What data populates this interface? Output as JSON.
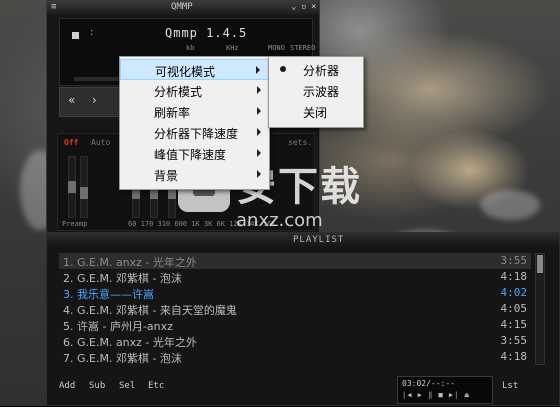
{
  "main_window": {
    "title": "QMMP",
    "version": "Qmmp 1.4.5",
    "colon": ":",
    "labels": {
      "kb": "kb",
      "khz": "KHz",
      "mono": "MONO",
      "stereo": "STEREO"
    },
    "controls": {
      "prev": "«",
      "play": "›"
    },
    "equalizer": {
      "off": "Off",
      "auto": "Auto",
      "presets": "sets.",
      "preamp": "Preamp",
      "freq": "60 170 310 600 1K 3K 6K 12K 14K 16K"
    }
  },
  "context_menu": {
    "items": [
      {
        "label": "可视化模式",
        "highlighted": true
      },
      {
        "label": "分析模式"
      },
      {
        "label": "刷新率"
      },
      {
        "label": "分析器下降速度"
      },
      {
        "label": "峰值下降速度"
      },
      {
        "label": "背景"
      }
    ]
  },
  "submenu": {
    "items": [
      {
        "label": "分析器",
        "checked": true
      },
      {
        "label": "示波器"
      },
      {
        "label": "关闭"
      }
    ]
  },
  "playlist": {
    "title": "PLAYLIST",
    "tracks": [
      {
        "title": "1. G.E.M. anxz - 光年之外",
        "duration": "3:55"
      },
      {
        "title": "2. G.E.M. 邓紫棋 - 泡沫",
        "duration": "4:18"
      },
      {
        "title": "3. 我乐意——许嵩",
        "duration": "4:02"
      },
      {
        "title": "4. G.E.M. 邓紫棋 - 来自天堂的魔鬼",
        "duration": "4:05"
      },
      {
        "title": "5. 许嵩 - 庐州月-anxz",
        "duration": "4:15"
      },
      {
        "title": "6. G.E.M. anxz - 光年之外",
        "duration": "3:55"
      },
      {
        "title": "7. G.E.M. 邓紫棋 - 泡沫",
        "duration": "4:18"
      }
    ],
    "buttons": {
      "add": "Add",
      "sub": "Sub",
      "sel": "Sel",
      "etc": "Etc",
      "lst": "Lst"
    },
    "mini_time": "03:02/--:--",
    "mini_controls": "|◀ ▶ ‖ ■ ▶| ⏏"
  },
  "watermark": {
    "text": "安下载",
    "url": "anxz.com"
  },
  "colors": {
    "current_track": "#4aa6ff",
    "eq_off": "#e03a1e",
    "menu_highlight": "#cde8ff"
  }
}
